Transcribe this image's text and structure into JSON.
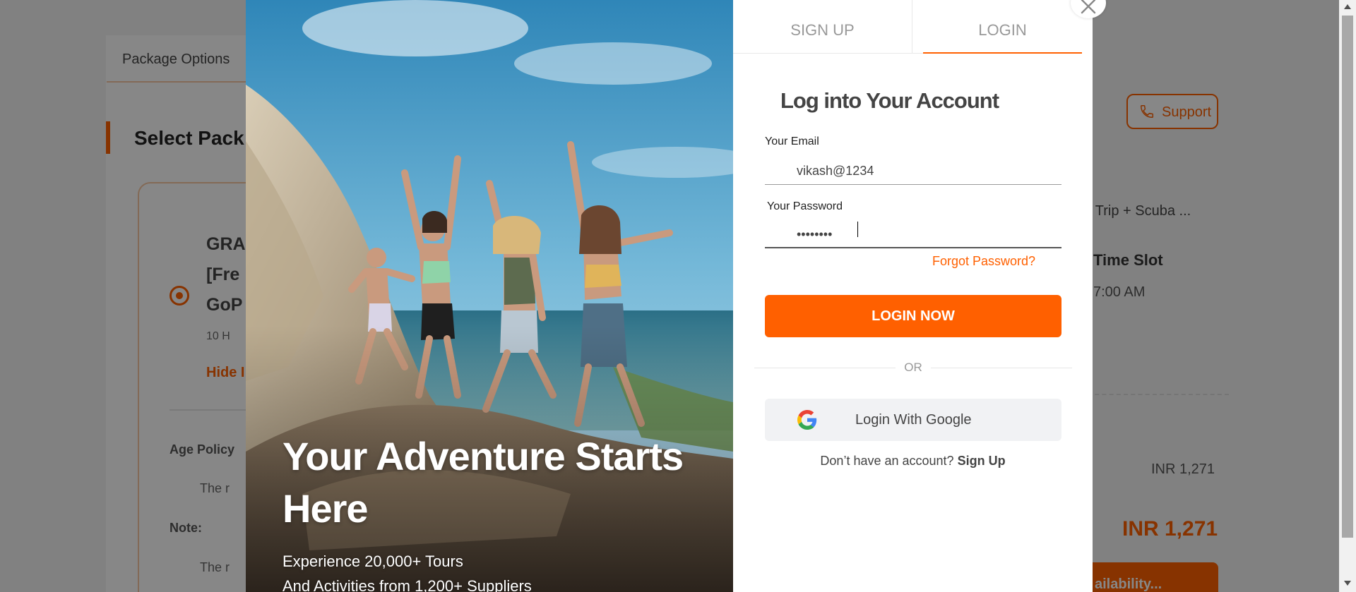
{
  "background_page": {
    "tab_label": "Package Options",
    "section_heading": "Select Pack",
    "package_title": "GRA [Fre GoP",
    "duration": "10 H",
    "hide_link": "Hide I",
    "age_policy": "Age Policy",
    "bullet_1": "The r",
    "note": "Note:",
    "bullet_2": "The r",
    "support_label": "Support",
    "sidebar_title": ": Trip + Scuba ...",
    "time_slot_label": "Time Slot",
    "time_slot_value": "7:00 AM",
    "price_subtotal": "INR 1,271",
    "price_total": "INR 1,271",
    "availability_button": "ailability..."
  },
  "modal": {
    "hero": {
      "title": "Your Adventure Starts Here",
      "subtitle_line1": "Experience 20,000+ Tours",
      "subtitle_line2": "And Activities from 1,200+ Suppliers"
    },
    "tabs": [
      {
        "label": "SIGN UP",
        "active": false
      },
      {
        "label": "LOGIN",
        "active": true
      }
    ],
    "title": "Log into Your Account",
    "email": {
      "label": "Your Email",
      "value": "vikash@1234"
    },
    "password": {
      "label": "Your Password",
      "value": "••••••••"
    },
    "forgot_password": "Forgot Password?",
    "login_button": "LOGIN NOW",
    "or_text": "OR",
    "google_button": "Login With Google",
    "signup_prompt": "Don’t have an account?",
    "signup_link": "Sign Up"
  },
  "colors": {
    "accent": "#ff6000",
    "overlay": "rgba(0,0,0,0.47)",
    "google_button_bg": "#f1f2f4"
  },
  "icons": [
    "close-icon",
    "google-icon",
    "phone-icon"
  ]
}
